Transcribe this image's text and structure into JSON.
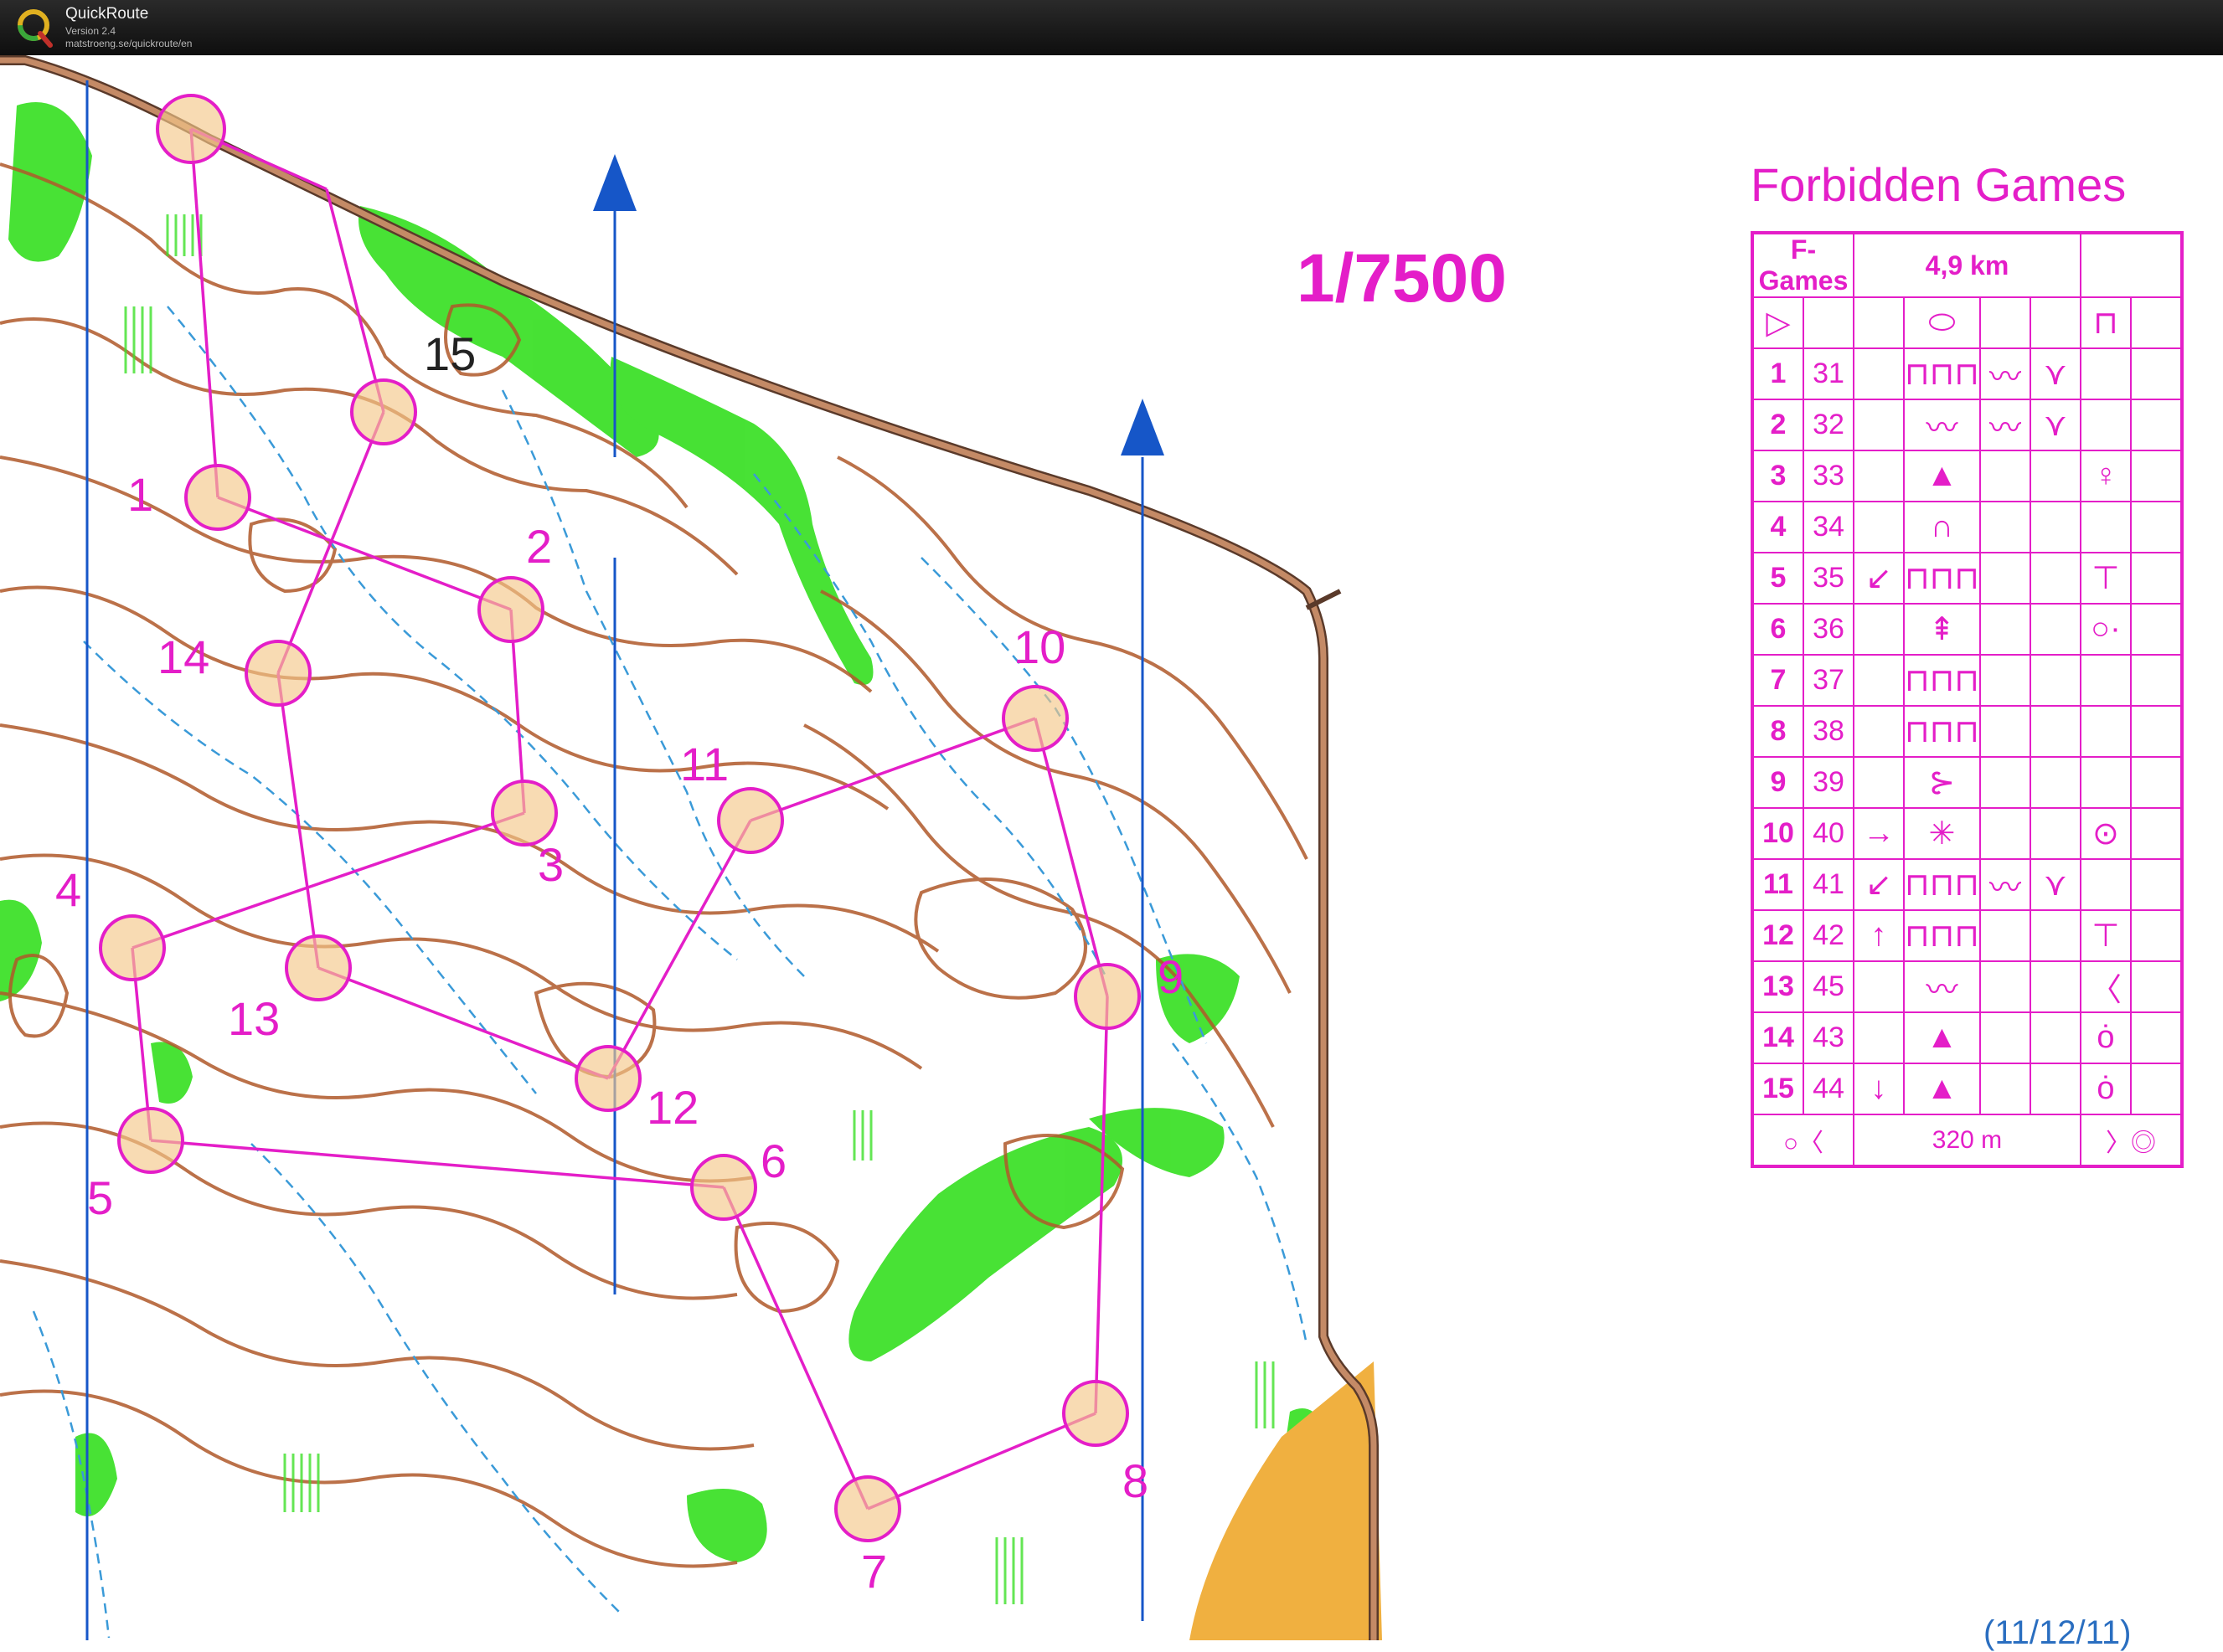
{
  "app": {
    "name": "QuickRoute",
    "version": "Version 2.4",
    "url": "matstroeng.se/quickroute/en"
  },
  "map": {
    "title": "Forbidden Games",
    "scale": "1/7500",
    "date": "(11/12/11)",
    "colors": {
      "course": "#e41ec8",
      "contour": "#b0592a",
      "forest_green": "#3ee02a",
      "water_blue": "#3a9ad8",
      "north_line": "#1656c8",
      "road": "#c48a66",
      "yellow_field": "#f0b040"
    },
    "controls": [
      {
        "label": "1",
        "code": "31"
      },
      {
        "label": "2",
        "code": "32"
      },
      {
        "label": "3",
        "code": "33"
      },
      {
        "label": "4",
        "code": "34"
      },
      {
        "label": "5",
        "code": "35"
      },
      {
        "label": "6",
        "code": "36"
      },
      {
        "label": "7",
        "code": "37"
      },
      {
        "label": "8",
        "code": "38"
      },
      {
        "label": "9",
        "code": "39"
      },
      {
        "label": "10",
        "code": "40"
      },
      {
        "label": "11",
        "code": "41"
      },
      {
        "label": "12",
        "code": "42"
      },
      {
        "label": "13",
        "code": "45"
      },
      {
        "label": "14",
        "code": "43"
      },
      {
        "label": "15",
        "code": "44"
      }
    ],
    "map_numbers": [
      "1",
      "2",
      "3",
      "4",
      "5",
      "6",
      "7",
      "8",
      "9",
      "10",
      "11",
      "12",
      "13",
      "14",
      "15"
    ]
  },
  "description": {
    "event": "F-Games",
    "length": "4,9 km",
    "finish_distance": "320 m",
    "rows": [
      {
        "num": "1",
        "code": "31",
        "c": "",
        "d": "⊓⊓⊓",
        "e": "〰",
        "f": "⋎",
        "g": "",
        "h": ""
      },
      {
        "num": "2",
        "code": "32",
        "c": "",
        "d": "〰",
        "e": "〰",
        "f": "⋎",
        "g": "",
        "h": ""
      },
      {
        "num": "3",
        "code": "33",
        "c": "",
        "d": "▲",
        "e": "",
        "f": "",
        "g": "♀",
        "h": ""
      },
      {
        "num": "4",
        "code": "34",
        "c": "",
        "d": "∩",
        "e": "",
        "f": "",
        "g": "",
        "h": ""
      },
      {
        "num": "5",
        "code": "35",
        "c": "↙",
        "d": "⊓⊓⊓",
        "e": "",
        "f": "",
        "g": "⊤",
        "h": ""
      },
      {
        "num": "6",
        "code": "36",
        "c": "",
        "d": "⇞",
        "e": "",
        "f": "",
        "g": "○·",
        "h": ""
      },
      {
        "num": "7",
        "code": "37",
        "c": "",
        "d": "⊓⊓⊓",
        "e": "",
        "f": "",
        "g": "",
        "h": ""
      },
      {
        "num": "8",
        "code": "38",
        "c": "",
        "d": "⊓⊓⊓",
        "e": "",
        "f": "",
        "g": "",
        "h": ""
      },
      {
        "num": "9",
        "code": "39",
        "c": "",
        "d": "⊱",
        "e": "",
        "f": "",
        "g": "",
        "h": ""
      },
      {
        "num": "10",
        "code": "40",
        "c": "→",
        "d": "✳",
        "e": "",
        "f": "",
        "g": "⊙",
        "h": ""
      },
      {
        "num": "11",
        "code": "41",
        "c": "↙",
        "d": "⊓⊓⊓",
        "e": "〰",
        "f": "⋎",
        "g": "",
        "h": ""
      },
      {
        "num": "12",
        "code": "42",
        "c": "↑",
        "d": "⊓⊓⊓",
        "e": "",
        "f": "",
        "g": "⊤",
        "h": ""
      },
      {
        "num": "13",
        "code": "45",
        "c": "",
        "d": "〰",
        "e": "",
        "f": "",
        "g": "〈",
        "h": ""
      },
      {
        "num": "14",
        "code": "43",
        "c": "",
        "d": "▲",
        "e": "",
        "f": "",
        "g": "ȯ",
        "h": ""
      },
      {
        "num": "15",
        "code": "44",
        "c": "↓",
        "d": "▲",
        "e": "",
        "f": "",
        "g": "ȯ",
        "h": ""
      }
    ]
  }
}
